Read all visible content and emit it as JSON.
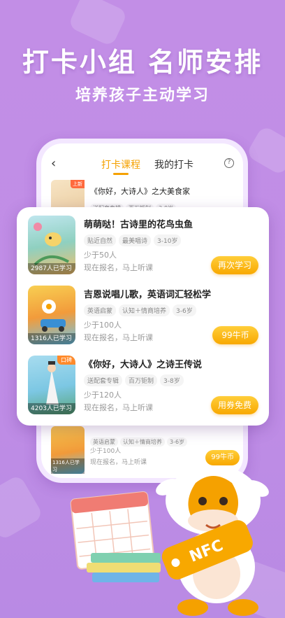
{
  "headline": "打卡小组  名师安排",
  "subline": "培养孩子主动学习",
  "phone": {
    "tabs": [
      "打卡课程",
      "我的打卡"
    ],
    "help_icon": "question-circle-icon",
    "bg_rows": [
      {
        "title": "《你好，大诗人》之大美食家",
        "tags": [
          "送配套专辑",
          "百万钜制",
          "3-8岁"
        ],
        "badge": "上新"
      },
      {
        "tags": [
          "英语启蒙",
          "认知＋情商培养",
          "3-6岁"
        ],
        "size": "少于100人",
        "status": "现在报名，马上听课",
        "count": "1316人已学习",
        "button": "99牛币"
      }
    ]
  },
  "courses": [
    {
      "title": "萌萌哒！古诗里的花鸟虫鱼",
      "tags": [
        "贴近自然",
        "最美唱诗",
        "3-10岁"
      ],
      "size": "少于50人",
      "status": "现在报名，马上听课",
      "count": "2987人已学习",
      "button": "再次学习",
      "badge": ""
    },
    {
      "title": "吉恩说唱儿歌，英语词汇轻松学",
      "tags": [
        "英语启蒙",
        "认知＋情商培养",
        "3-6岁"
      ],
      "size": "少于100人",
      "status": "现在报名，马上听课",
      "count": "1316人已学习",
      "button": "99牛币",
      "badge": ""
    },
    {
      "title": "《你好，大诗人》之诗王传说",
      "tags": [
        "送配套专辑",
        "百万钜制",
        "3-8岁"
      ],
      "size": "少于120人",
      "status": "现在报名，马上听课",
      "count": "4203人已学习",
      "button": "用券免费",
      "badge": "口碑"
    }
  ],
  "nfc_label": "NFC",
  "deco_label": "NFC",
  "colors": {
    "accent": "#f5a100",
    "background": "#c28ee6"
  }
}
